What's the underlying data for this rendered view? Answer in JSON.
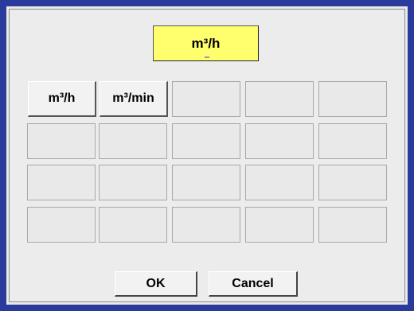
{
  "display": {
    "value": "m³/h"
  },
  "units": [
    {
      "label": "m³/h"
    },
    {
      "label": "m³/min"
    }
  ],
  "buttons": {
    "ok_label": "OK",
    "cancel_label": "Cancel"
  },
  "colors": {
    "frame": "#2a3b9c",
    "display_bg": "#ffff6e",
    "dialog_bg": "#e9e9e9"
  }
}
